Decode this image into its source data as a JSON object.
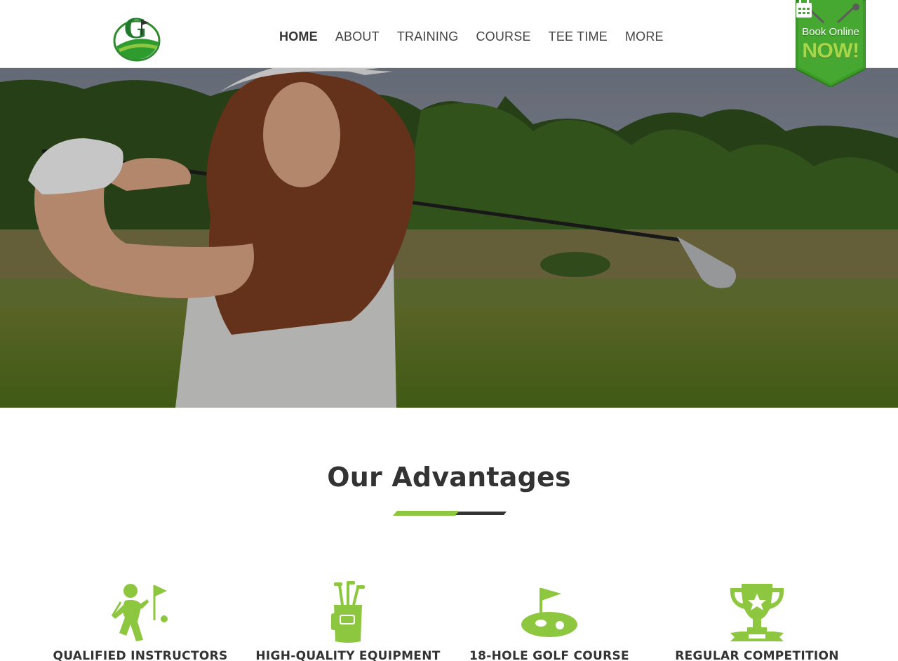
{
  "header": {
    "logo_letter": "G",
    "nav": [
      {
        "label": "HOME",
        "active": true
      },
      {
        "label": "ABOUT",
        "active": false
      },
      {
        "label": "TRAINING",
        "active": false
      },
      {
        "label": "COURSE",
        "active": false
      },
      {
        "label": "TEE TIME",
        "active": false
      },
      {
        "label": "MORE",
        "active": false
      }
    ],
    "book": {
      "line1": "Book Online",
      "line2": "NOW!",
      "icon": "calendar-icon"
    }
  },
  "hero": {
    "image": "woman-golfer-swing-photo"
  },
  "advantages": {
    "title": "Our Advantages",
    "items": [
      {
        "label": "QUALIFIED INSTRUCTORS",
        "icon": "golfer-icon"
      },
      {
        "label": "HIGH-QUALITY EQUIPMENT",
        "icon": "golf-bag-icon"
      },
      {
        "label": "18-HOLE GOLF COURSE",
        "icon": "golf-hole-icon"
      },
      {
        "label": "REGULAR COMPETITION",
        "icon": "trophy-icon"
      }
    ]
  },
  "colors": {
    "accent": "#8dc63f",
    "dark": "#333333",
    "badge": "#3e9b2a"
  }
}
